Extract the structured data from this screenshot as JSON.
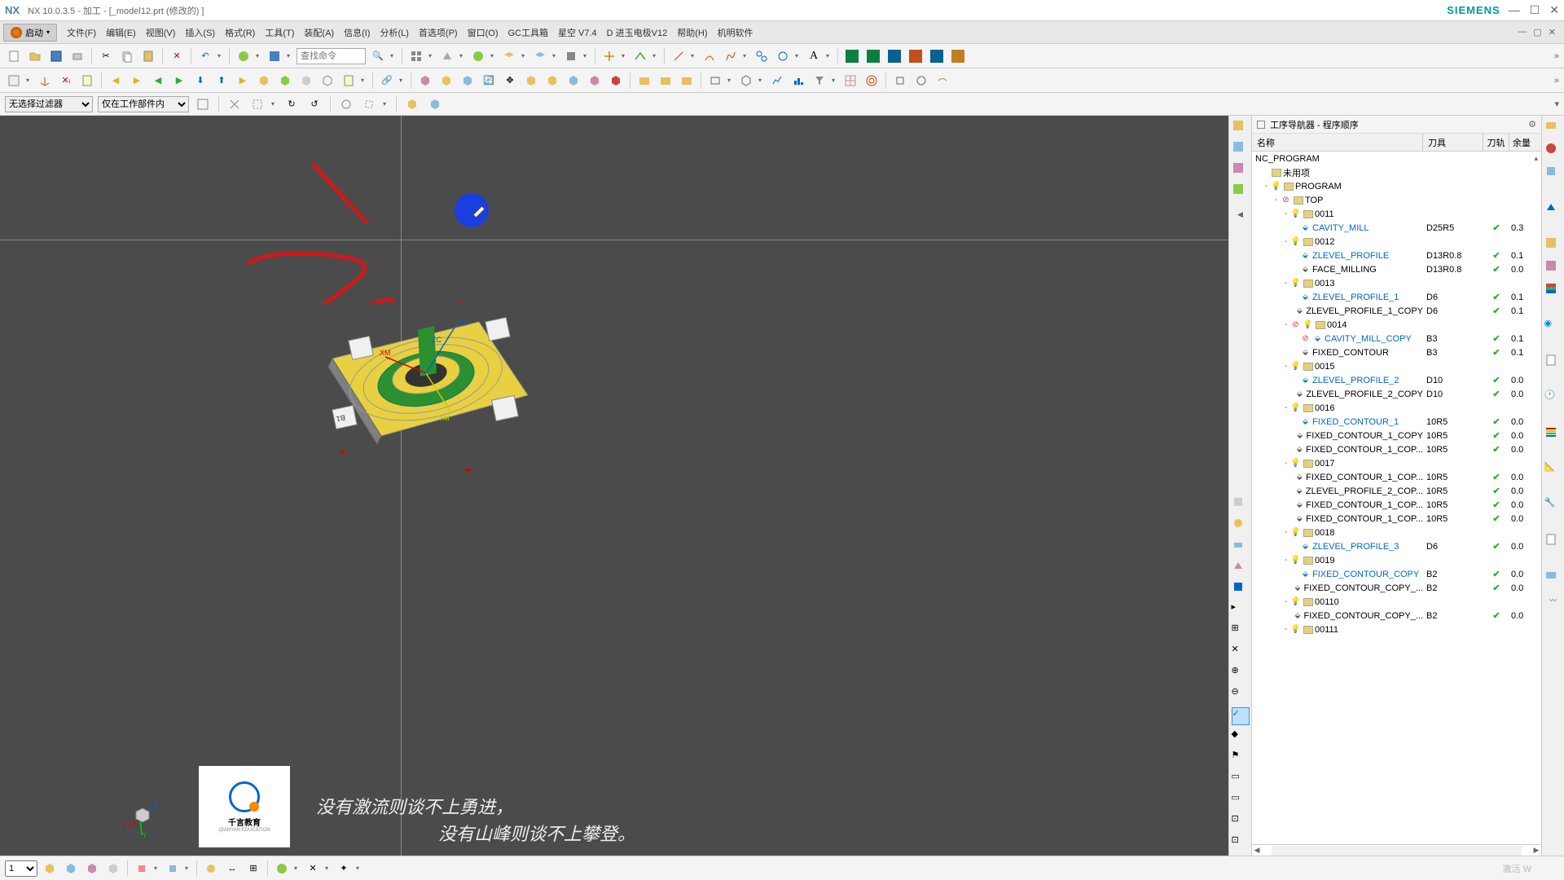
{
  "titlebar": {
    "nx": "NX",
    "text": "NX 10.0.3.5 - 加工 - [_model12.prt  (修改的) ]",
    "brand": "SIEMENS"
  },
  "menubar": {
    "start": "启动",
    "items": [
      "文件(F)",
      "编辑(E)",
      "视图(V)",
      "插入(S)",
      "格式(R)",
      "工具(T)",
      "装配(A)",
      "信息(I)",
      "分析(L)",
      "首选项(P)",
      "窗口(O)",
      "GC工具箱",
      "星空 V7.4",
      "D 进玉电极V12",
      "帮助(H)",
      "机明软件"
    ]
  },
  "toolbar": {
    "search_placeholder": "查找命令"
  },
  "filterbar": {
    "filter1": "无选择过滤器",
    "filter2": "仅在工作部件内"
  },
  "navigator": {
    "title": "工序导航器 - 程序顺序",
    "cols": {
      "name": "名称",
      "tool": "刀具",
      "path": "刀轨",
      "rem": "余量"
    },
    "root": "NC_PROGRAM",
    "unused": "未用项",
    "program": "PROGRAM",
    "top": "TOP",
    "groups": [
      {
        "id": "0011",
        "ops": [
          {
            "n": "CAVITY_MILL",
            "t": "D25R5",
            "r": "0.3",
            "link": true
          }
        ]
      },
      {
        "id": "0012",
        "ops": [
          {
            "n": "ZLEVEL_PROFILE",
            "t": "D13R0.8",
            "r": "0.1",
            "link": true
          },
          {
            "n": "FACE_MILLING",
            "t": "D13R0.8",
            "r": "0.0",
            "link": false
          }
        ]
      },
      {
        "id": "0013",
        "ops": [
          {
            "n": "ZLEVEL_PROFILE_1",
            "t": "D6",
            "r": "0.1",
            "link": true
          },
          {
            "n": "ZLEVEL_PROFILE_1_COPY",
            "t": "D6",
            "r": "0.1",
            "link": false
          }
        ]
      },
      {
        "id": "0014",
        "ban": true,
        "ops": [
          {
            "n": "CAVITY_MILL_COPY",
            "t": "B3",
            "r": "0.1",
            "link": true,
            "ban": true
          },
          {
            "n": "FIXED_CONTOUR",
            "t": "B3",
            "r": "0.1",
            "link": false
          }
        ]
      },
      {
        "id": "0015",
        "ops": [
          {
            "n": "ZLEVEL_PROFILE_2",
            "t": "D10",
            "r": "0.0",
            "link": true
          },
          {
            "n": "ZLEVEL_PROFILE_2_COPY",
            "t": "D10",
            "r": "0.0",
            "link": false
          }
        ]
      },
      {
        "id": "0016",
        "ops": [
          {
            "n": "FIXED_CONTOUR_1",
            "t": "10R5",
            "r": "0.0",
            "link": true
          },
          {
            "n": "FIXED_CONTOUR_1_COPY",
            "t": "10R5",
            "r": "0.0",
            "link": false
          },
          {
            "n": "FIXED_CONTOUR_1_COP...",
            "t": "10R5",
            "r": "0.0",
            "link": false
          }
        ]
      },
      {
        "id": "0017",
        "ops": [
          {
            "n": "FIXED_CONTOUR_1_COP...",
            "t": "10R5",
            "r": "0.0",
            "link": false
          },
          {
            "n": "ZLEVEL_PROFILE_2_COP...",
            "t": "10R5",
            "r": "0.0",
            "link": false
          },
          {
            "n": "FIXED_CONTOUR_1_COP...",
            "t": "10R5",
            "r": "0.0",
            "link": false
          },
          {
            "n": "FIXED_CONTOUR_1_COP...",
            "t": "10R5",
            "r": "0.0",
            "link": false
          }
        ]
      },
      {
        "id": "0018",
        "ops": [
          {
            "n": "ZLEVEL_PROFILE_3",
            "t": "D6",
            "r": "0.0",
            "link": true
          }
        ]
      },
      {
        "id": "0019",
        "ops": [
          {
            "n": "FIXED_CONTOUR_COPY",
            "t": "B2",
            "r": "0.0",
            "link": true
          },
          {
            "n": "FIXED_CONTOUR_COPY_...",
            "t": "B2",
            "r": "0.0",
            "link": false
          }
        ]
      },
      {
        "id": "00110",
        "ops": [
          {
            "n": "FIXED_CONTOUR_COPY_...",
            "t": "B2",
            "r": "0.0",
            "link": false
          }
        ]
      },
      {
        "id": "00111",
        "ops": []
      }
    ]
  },
  "logo": {
    "name": "千言教育",
    "sub": "QIANYAN EDUCATION"
  },
  "subtitle": {
    "l1": "没有激流则谈不上勇进，",
    "l2": "没有山峰则谈不上攀登。"
  },
  "watermark": "激活 W",
  "axes": {
    "xm": "XM",
    "ym": "YM",
    "zm": "ZM",
    "zc": "ZC"
  },
  "bottombar": {
    "zoom": "1"
  }
}
